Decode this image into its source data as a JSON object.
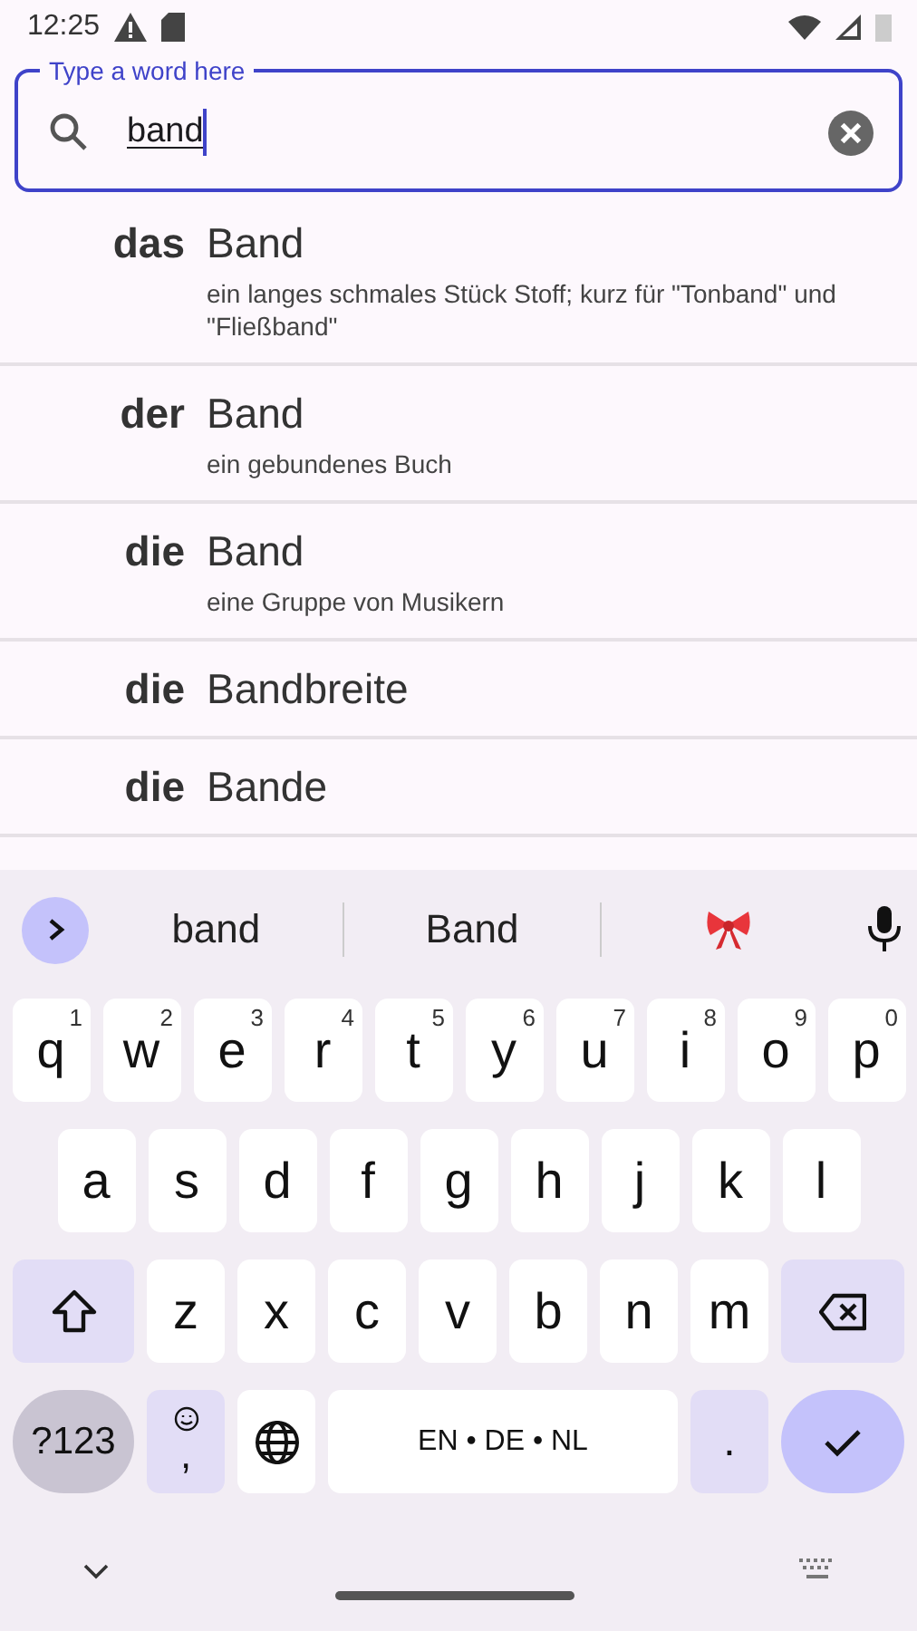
{
  "status_bar": {
    "time": "12:25"
  },
  "search": {
    "label": "Type a word here",
    "value": "band"
  },
  "results": [
    {
      "article": "das",
      "word": "Band",
      "definition": "ein langes schmales Stück Stoff; kurz für \"Tonband\" und \"Fließband\""
    },
    {
      "article": "der",
      "word": "Band",
      "definition": "ein gebundenes Buch"
    },
    {
      "article": "die",
      "word": "Band",
      "definition": "eine Gruppe von Musikern"
    },
    {
      "article": "die",
      "word": "Bandbreite"
    },
    {
      "article": "die",
      "word": "Bande"
    }
  ],
  "keyboard": {
    "suggestions": [
      {
        "kind": "word",
        "text": "band"
      },
      {
        "kind": "word",
        "text": "Band"
      },
      {
        "kind": "emoji"
      }
    ],
    "rows": [
      {
        "keys": [
          {
            "kind": "letter",
            "label": "q",
            "hint": "1"
          },
          {
            "kind": "letter",
            "label": "w",
            "hint": "2"
          },
          {
            "kind": "letter",
            "label": "e",
            "hint": "3"
          },
          {
            "kind": "letter",
            "label": "r",
            "hint": "4"
          },
          {
            "kind": "letter",
            "label": "t",
            "hint": "5"
          },
          {
            "kind": "letter",
            "label": "y",
            "hint": "6"
          },
          {
            "kind": "letter",
            "label": "u",
            "hint": "7"
          },
          {
            "kind": "letter",
            "label": "i",
            "hint": "8"
          },
          {
            "kind": "letter",
            "label": "o",
            "hint": "9"
          },
          {
            "kind": "letter",
            "label": "p",
            "hint": "0"
          }
        ]
      },
      {
        "keys": [
          {
            "kind": "letter",
            "label": "a"
          },
          {
            "kind": "letter",
            "label": "s"
          },
          {
            "kind": "letter",
            "label": "d"
          },
          {
            "kind": "letter",
            "label": "f"
          },
          {
            "kind": "letter",
            "label": "g"
          },
          {
            "kind": "letter",
            "label": "h"
          },
          {
            "kind": "letter",
            "label": "j"
          },
          {
            "kind": "letter",
            "label": "k"
          },
          {
            "kind": "letter",
            "label": "l"
          }
        ]
      },
      {
        "keys": [
          {
            "kind": "shift"
          },
          {
            "kind": "letter",
            "label": "z"
          },
          {
            "kind": "letter",
            "label": "x"
          },
          {
            "kind": "letter",
            "label": "c"
          },
          {
            "kind": "letter",
            "label": "v"
          },
          {
            "kind": "letter",
            "label": "b"
          },
          {
            "kind": "letter",
            "label": "n"
          },
          {
            "kind": "letter",
            "label": "m"
          },
          {
            "kind": "backspace"
          }
        ]
      },
      {
        "keys": [
          {
            "kind": "symbols",
            "label": "?123"
          },
          {
            "kind": "emoji-comma",
            "label": ","
          },
          {
            "kind": "globe"
          },
          {
            "kind": "space",
            "label": "EN • DE • NL"
          },
          {
            "kind": "period",
            "label": "."
          },
          {
            "kind": "enter"
          }
        ]
      }
    ]
  }
}
